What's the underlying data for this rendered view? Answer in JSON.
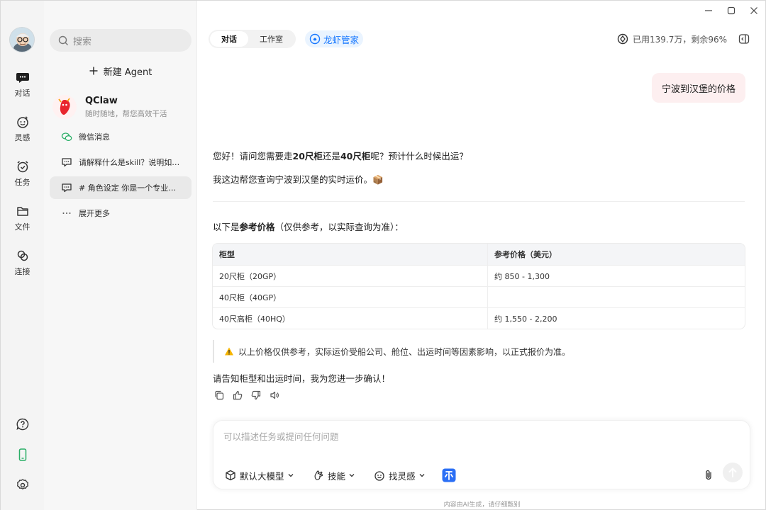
{
  "window": {
    "controls": [
      "minimize-icon",
      "maximize-icon",
      "close-icon"
    ]
  },
  "rail": {
    "items": [
      {
        "label": "对话",
        "icon": "chat-icon"
      },
      {
        "label": "灵感",
        "icon": "inspiration-icon"
      },
      {
        "label": "任务",
        "icon": "alarm-icon"
      },
      {
        "label": "文件",
        "icon": "folder-icon"
      },
      {
        "label": "连接",
        "icon": "link-icon"
      }
    ],
    "bottom": [
      "help-icon",
      "phone-icon",
      "settings-icon"
    ]
  },
  "sidebar": {
    "search_placeholder": "搜索",
    "new_agent_label": "新建 Agent",
    "agent": {
      "name": "QClaw",
      "subtitle": "随时随地，帮您高效干活"
    },
    "items": [
      {
        "label": "微信消息",
        "icon": "wechat-icon"
      },
      {
        "label": "请解释什么是skill？说明如何…",
        "icon": "message-icon"
      },
      {
        "label": "# 角色设定 你是一个专业的…",
        "icon": "message-icon"
      },
      {
        "label": "展开更多",
        "icon": "more-icon"
      }
    ]
  },
  "header": {
    "tabs": [
      "对话",
      "工作室"
    ],
    "active_tab": "对话",
    "brand_tab": "龙虾管家",
    "usage": "已用139.7万，剩余96%"
  },
  "conversation": {
    "user_message": "宁波到汉堡的价格",
    "reply_line1_parts": [
      "您好！请问您需要走",
      "20尺柜",
      "还是",
      "40尺柜",
      "呢？预计什么时候出运？"
    ],
    "reply_line2": "我这边帮您查询宁波到汉堡的实时运价。📦",
    "reference_parts": [
      "以下是",
      "参考价格",
      "（仅供参考，以实际查询为准）："
    ],
    "table": {
      "headers": [
        "柜型",
        "参考价格（美元）"
      ],
      "rows": [
        [
          "20尺柜（20GP）",
          "约 850 - 1,300"
        ],
        [
          "40尺柜（40GP）",
          ""
        ],
        [
          "40尺高柜（40HQ）",
          "约 1,550 - 2,200"
        ]
      ]
    },
    "note": "以上价格仅供参考，实际运价受船公司、舱位、出运时间等因素影响，以正式报价为准。",
    "closing": "请告知柜型和出运时间，我为您进一步确认！",
    "actions": [
      "copy-icon",
      "thumbs-up-icon",
      "thumbs-down-icon",
      "speaker-icon"
    ]
  },
  "composer": {
    "placeholder": "可以描述任务或提问任何问题",
    "model_label": "默认大模型",
    "skills_label": "技能",
    "inspiration_label": "找灵感"
  },
  "footer": "内容由AI生成，请仔细甄别",
  "colors": {
    "accent": "#1677ff",
    "user_bubble": "#fdeff0",
    "green": "#2aae67"
  }
}
